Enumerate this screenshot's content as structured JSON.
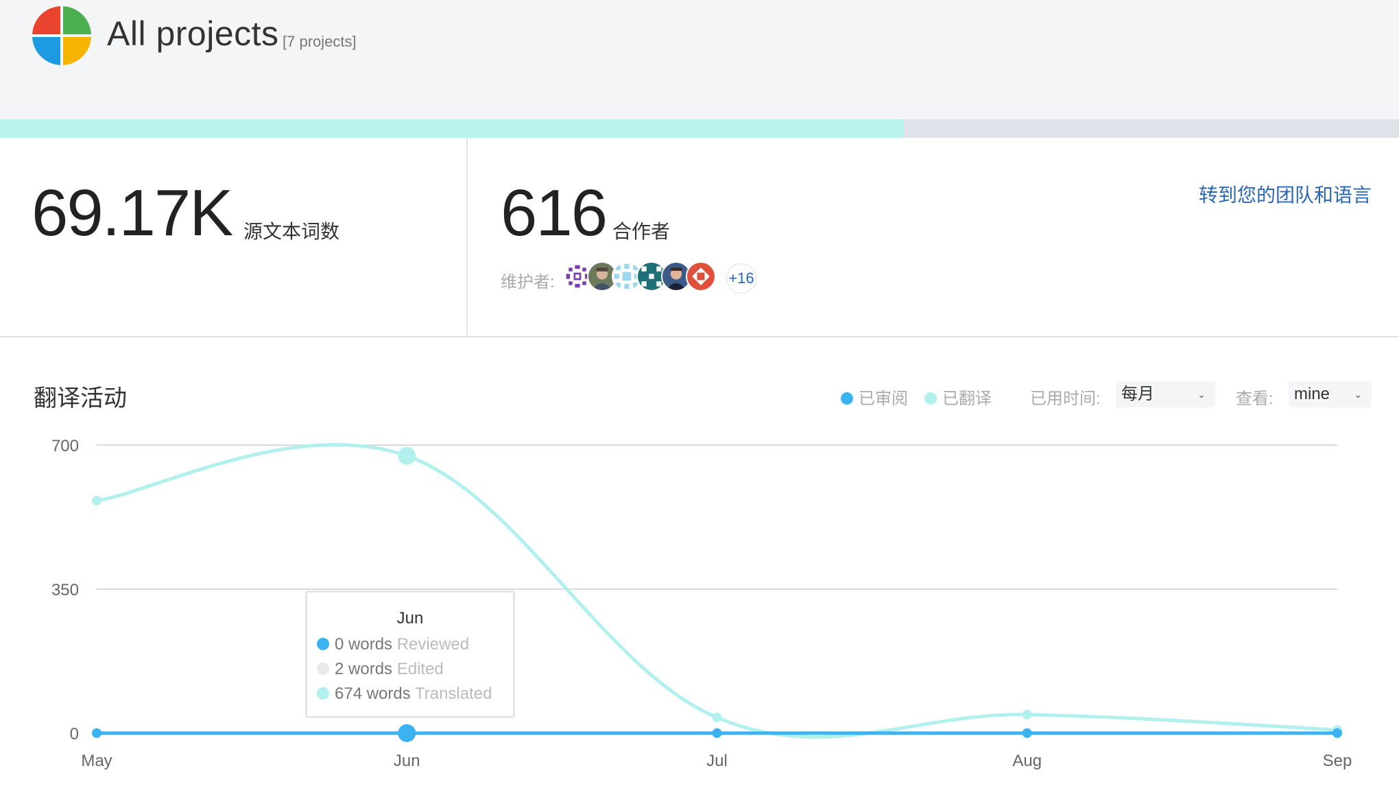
{
  "header": {
    "title": "All projects",
    "project_count": "[7 projects]",
    "logo_colors": [
      "#e8442e",
      "#4caf50",
      "#1e9be0",
      "#f5b400"
    ],
    "progress_fraction": 0.646
  },
  "stats": {
    "words_value": "69.17K",
    "words_label": "源文本词数",
    "contributors_value": "616",
    "contributors_label": "合作者",
    "team_link": "转到您的团队和语言",
    "maintainers_label": "维护者:",
    "maintainers_more": "+16",
    "maintainer_avatars": [
      "pattern-purple",
      "photo-man",
      "pattern-lightblue",
      "pattern-teal",
      "photo-man-2",
      "pattern-red"
    ]
  },
  "activity": {
    "title": "翻译活动",
    "legend_reviewed": "已审阅",
    "legend_translated": "已翻译",
    "period_label": "已用时间:",
    "period_value": "每月",
    "view_label": "查看:",
    "view_value": "mine",
    "reviewed_color": "#3bb3f0",
    "translated_color": "#b2f0ee",
    "edited_color": "#e9e9e9"
  },
  "tooltip": {
    "title": "Jun",
    "reviewed_count": "0 words",
    "reviewed_label": "Reviewed",
    "edited_count": "2 words",
    "edited_label": "Edited",
    "translated_count": "674 words",
    "translated_label": "Translated"
  },
  "chart_data": {
    "type": "line",
    "categories": [
      "May",
      "Jun",
      "Jul",
      "Aug",
      "Sep"
    ],
    "yticks": [
      "0",
      "350",
      "700"
    ],
    "ylim": [
      0,
      700
    ],
    "series": [
      {
        "name": "已审阅",
        "values": [
          0,
          0,
          0,
          0,
          0
        ]
      },
      {
        "name": "已翻译",
        "values": [
          565,
          674,
          38,
          45,
          8
        ]
      }
    ],
    "highlighted_category": "Jun",
    "grid": true
  }
}
